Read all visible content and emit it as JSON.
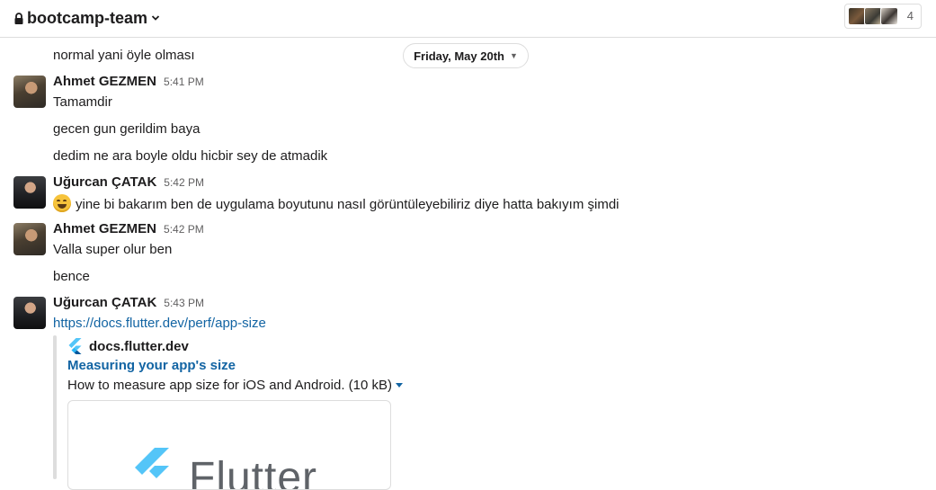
{
  "header": {
    "channel_name": "bootcamp-team",
    "member_count": "4",
    "icons": [
      "lock-icon",
      "chevron-down-icon"
    ]
  },
  "date_divider": "Friday, May 20th",
  "messages": [
    {
      "continuation": "normal yani öyle olması"
    },
    {
      "author": "Ahmet GEZMEN",
      "time": "5:41 PM",
      "lines": [
        "Tamamdir",
        "gecen gun gerildim baya",
        "dedim ne ara boyle oldu hicbir sey de atmadik"
      ]
    },
    {
      "author": "Uğurcan ÇATAK",
      "time": "5:42 PM",
      "lines": [
        "yine bi bakarım ben de uygulama boyutunu nasıl görüntüleyebiliriz diye hatta bakıyım şimdi"
      ],
      "emoji": "smile-emoji"
    },
    {
      "author": "Ahmet GEZMEN",
      "time": "5:42 PM",
      "lines": [
        "Valla super olur ben",
        "bence"
      ]
    },
    {
      "author": "Uğurcan ÇATAK",
      "time": "5:43 PM",
      "link": "https://docs.flutter.dev/perf/app-size"
    }
  ],
  "attachment": {
    "site": "docs.flutter.dev",
    "title": "Measuring your app's size",
    "description": "How to measure app size for iOS and Android. (10 kB)",
    "preview_text": "Flutter",
    "icon": "flutter-icon",
    "accent_color": "#1264a3"
  }
}
